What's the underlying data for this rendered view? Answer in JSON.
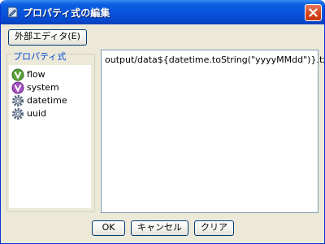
{
  "window": {
    "title": "プロパティ式の編集"
  },
  "toolbar": {
    "external_editor_label": "外部エディタ(E)"
  },
  "properties": {
    "group_title": "プロパティ式",
    "items": [
      {
        "label": "flow",
        "icon": "green-v-icon"
      },
      {
        "label": "system",
        "icon": "purple-v-icon"
      },
      {
        "label": "datetime",
        "icon": "gear-icon"
      },
      {
        "label": "uuid",
        "icon": "gear-icon"
      }
    ]
  },
  "editor": {
    "value": "output/data${datetime.toString(\"yyyyMMdd\")}.txt"
  },
  "footer": {
    "ok_label": "OK",
    "cancel_label": "キャンセル",
    "clear_label": "クリア"
  },
  "colors": {
    "titlebar": "#0854dd",
    "dialog_bg": "#ece9d8",
    "group_title": "#0046d5",
    "close_button": "#d8421a"
  }
}
